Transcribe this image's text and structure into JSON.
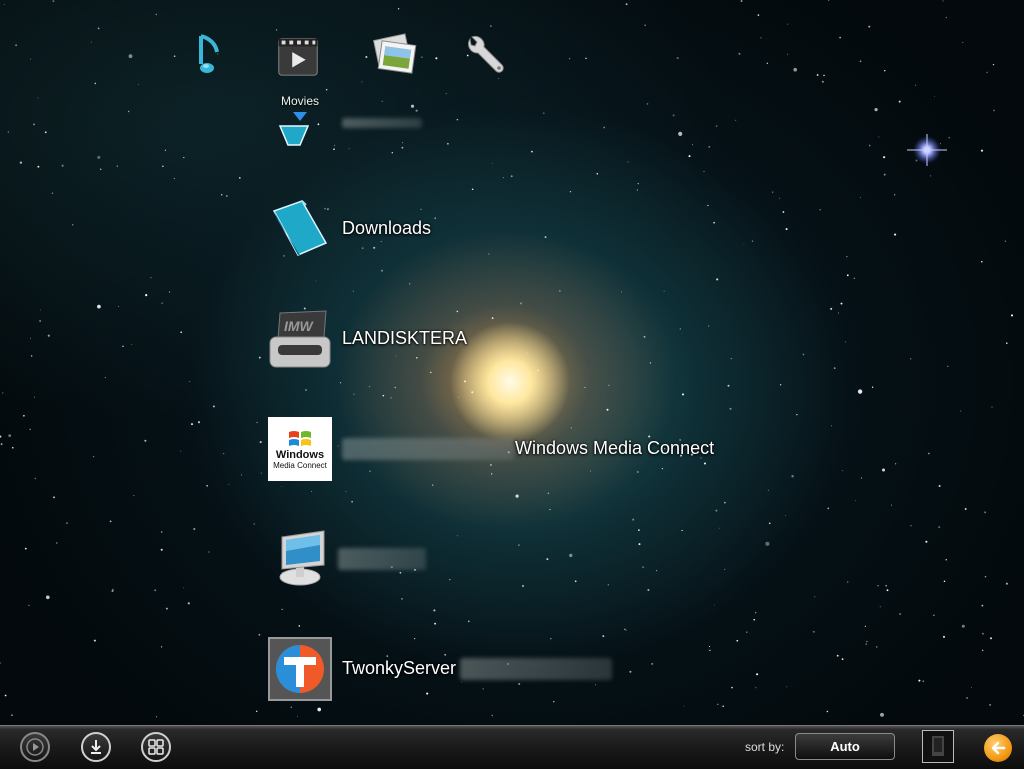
{
  "top_nav": {
    "items": [
      {
        "icon": "music-note-icon"
      },
      {
        "icon": "movies-icon",
        "label": "Movies",
        "selected": true
      },
      {
        "icon": "photos-icon"
      },
      {
        "icon": "settings-wrench-icon"
      }
    ]
  },
  "sources": [
    {
      "icon": "shared-folder-icon",
      "label": ""
    },
    {
      "icon": "downloads-folder-icon",
      "label": "Downloads"
    },
    {
      "icon": "nas-drive-icon",
      "label": "LANDISKTERA"
    },
    {
      "icon": "windows-media-connect-icon",
      "label": "Windows Media Connect",
      "icon_text": [
        "Windows",
        "Media Connect"
      ]
    },
    {
      "icon": "computer-monitor-icon",
      "label": ""
    },
    {
      "icon": "twonky-icon",
      "label": "TwonkyServer"
    }
  ],
  "bottom_bar": {
    "play_icon": "play-circle-icon",
    "download_icon": "download-circle-icon",
    "grid_icon": "grid-circle-icon",
    "sort_label": "sort by:",
    "sort_value": "Auto",
    "back_icon": "back-arrow-icon"
  },
  "colors": {
    "selection_arrow": "#2d8fe8",
    "back_button": "#f39a16",
    "folder_teal": "#1fa8c8"
  }
}
